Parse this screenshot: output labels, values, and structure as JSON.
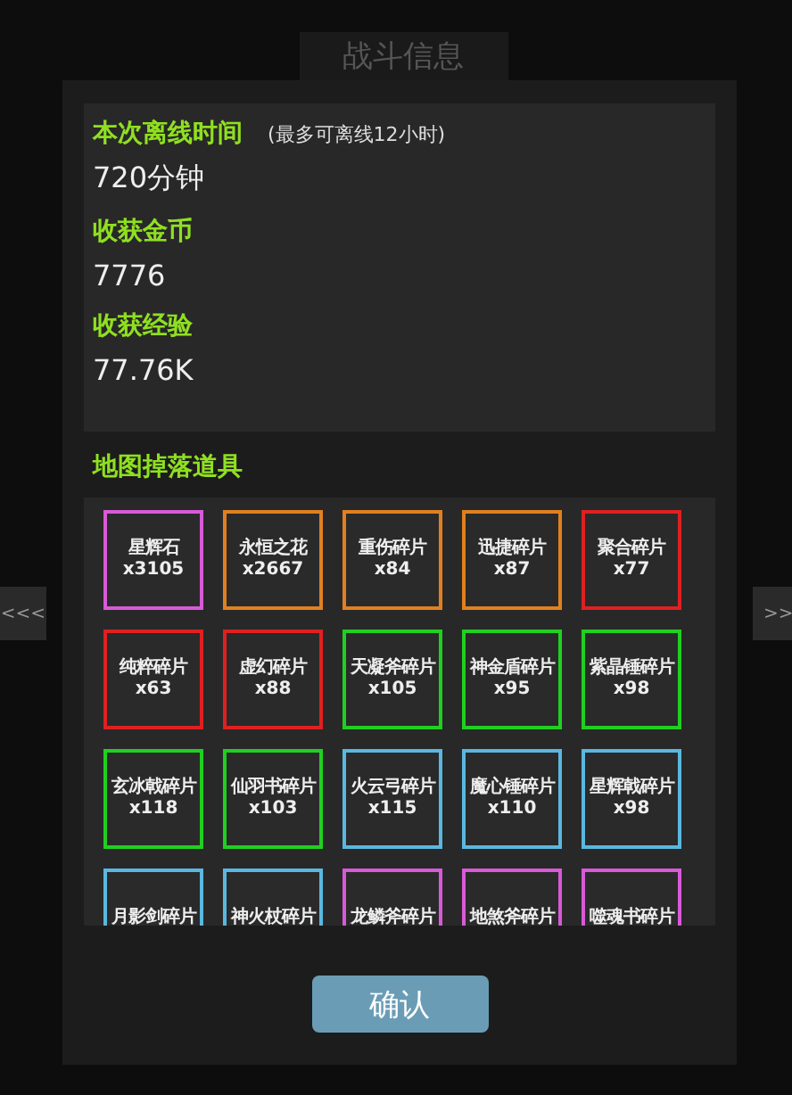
{
  "title_tab": "战斗信息",
  "nav": {
    "prev": "<<<",
    "next": ">>"
  },
  "info": [
    {
      "label": "本次离线时间",
      "note": "(最多可离线12小时)",
      "value": "720分钟"
    },
    {
      "label": "收获金币",
      "value": "7776"
    },
    {
      "label": "收获经验",
      "value": "77.76K"
    }
  ],
  "drops": {
    "title": "地图掉落道具",
    "items": [
      {
        "name": "星辉石",
        "count": "x3105",
        "color": "#d85ad8"
      },
      {
        "name": "永恒之花",
        "count": "x2667",
        "color": "#e08020"
      },
      {
        "name": "重伤碎片",
        "count": "x84",
        "color": "#e08020"
      },
      {
        "name": "迅捷碎片",
        "count": "x87",
        "color": "#e08020"
      },
      {
        "name": "聚合碎片",
        "count": "x77",
        "color": "#e02020"
      },
      {
        "name": "纯粹碎片",
        "count": "x63",
        "color": "#e02020"
      },
      {
        "name": "虚幻碎片",
        "count": "x88",
        "color": "#e02020"
      },
      {
        "name": "天凝斧碎片",
        "count": "x105",
        "color": "#20d020"
      },
      {
        "name": "神金盾碎片",
        "count": "x95",
        "color": "#20d020"
      },
      {
        "name": "紫晶锤碎片",
        "count": "x98",
        "color": "#20d020"
      },
      {
        "name": "玄冰戟碎片",
        "count": "x118",
        "color": "#20d020"
      },
      {
        "name": "仙羽书碎片",
        "count": "x103",
        "color": "#20d020"
      },
      {
        "name": "火云弓碎片",
        "count": "x115",
        "color": "#5ab8e0"
      },
      {
        "name": "魔心锤碎片",
        "count": "x110",
        "color": "#5ab8e0"
      },
      {
        "name": "星辉戟碎片",
        "count": "x98",
        "color": "#5ab8e0"
      },
      {
        "name": "月影剑碎片",
        "color": "#5ab8e0"
      },
      {
        "name": "神火杖碎片",
        "color": "#5ab8e0"
      },
      {
        "name": "龙鳞斧碎片",
        "color": "#d85ad8"
      },
      {
        "name": "地煞斧碎片",
        "color": "#d85ad8"
      },
      {
        "name": "噬魂书碎片",
        "color": "#d85ad8"
      }
    ]
  },
  "confirm": "确认"
}
